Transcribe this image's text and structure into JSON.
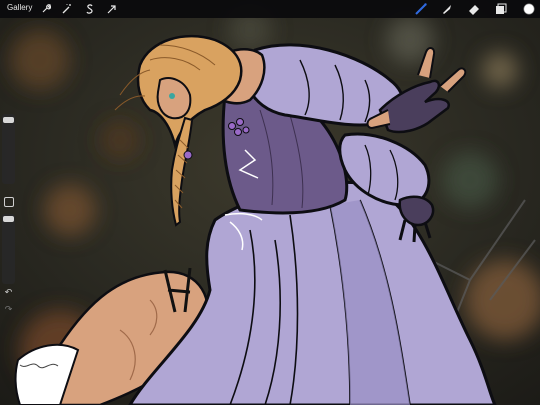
{
  "toolbar": {
    "gallery_label": "Gallery",
    "left_tools": [
      "wrench-icon",
      "magic-wand-icon",
      "selection-s-icon",
      "transform-arrow-icon"
    ],
    "right_tools": [
      "brush-icon",
      "smudge-icon",
      "eraser-icon",
      "layers-icon",
      "color-swatch-icon"
    ],
    "active_tool": "brush-icon",
    "accent_color": "#2f6ae0",
    "current_color": "#ffffff"
  },
  "sidebar": {
    "brush_size": 0.96,
    "opacity": 0.99,
    "modify_button": "square-icon",
    "undo": "undo-arrow-icon",
    "redo": "redo-arrow-icon"
  },
  "artwork": {
    "palette": {
      "dress": "#b0a6d4",
      "dress_shadow": "#8e82b8",
      "corset": "#6c5a8a",
      "hair": "#d9a260",
      "skin": "#d8a27e",
      "glove": "#4a3e5c",
      "line": "#0d0d12"
    }
  }
}
